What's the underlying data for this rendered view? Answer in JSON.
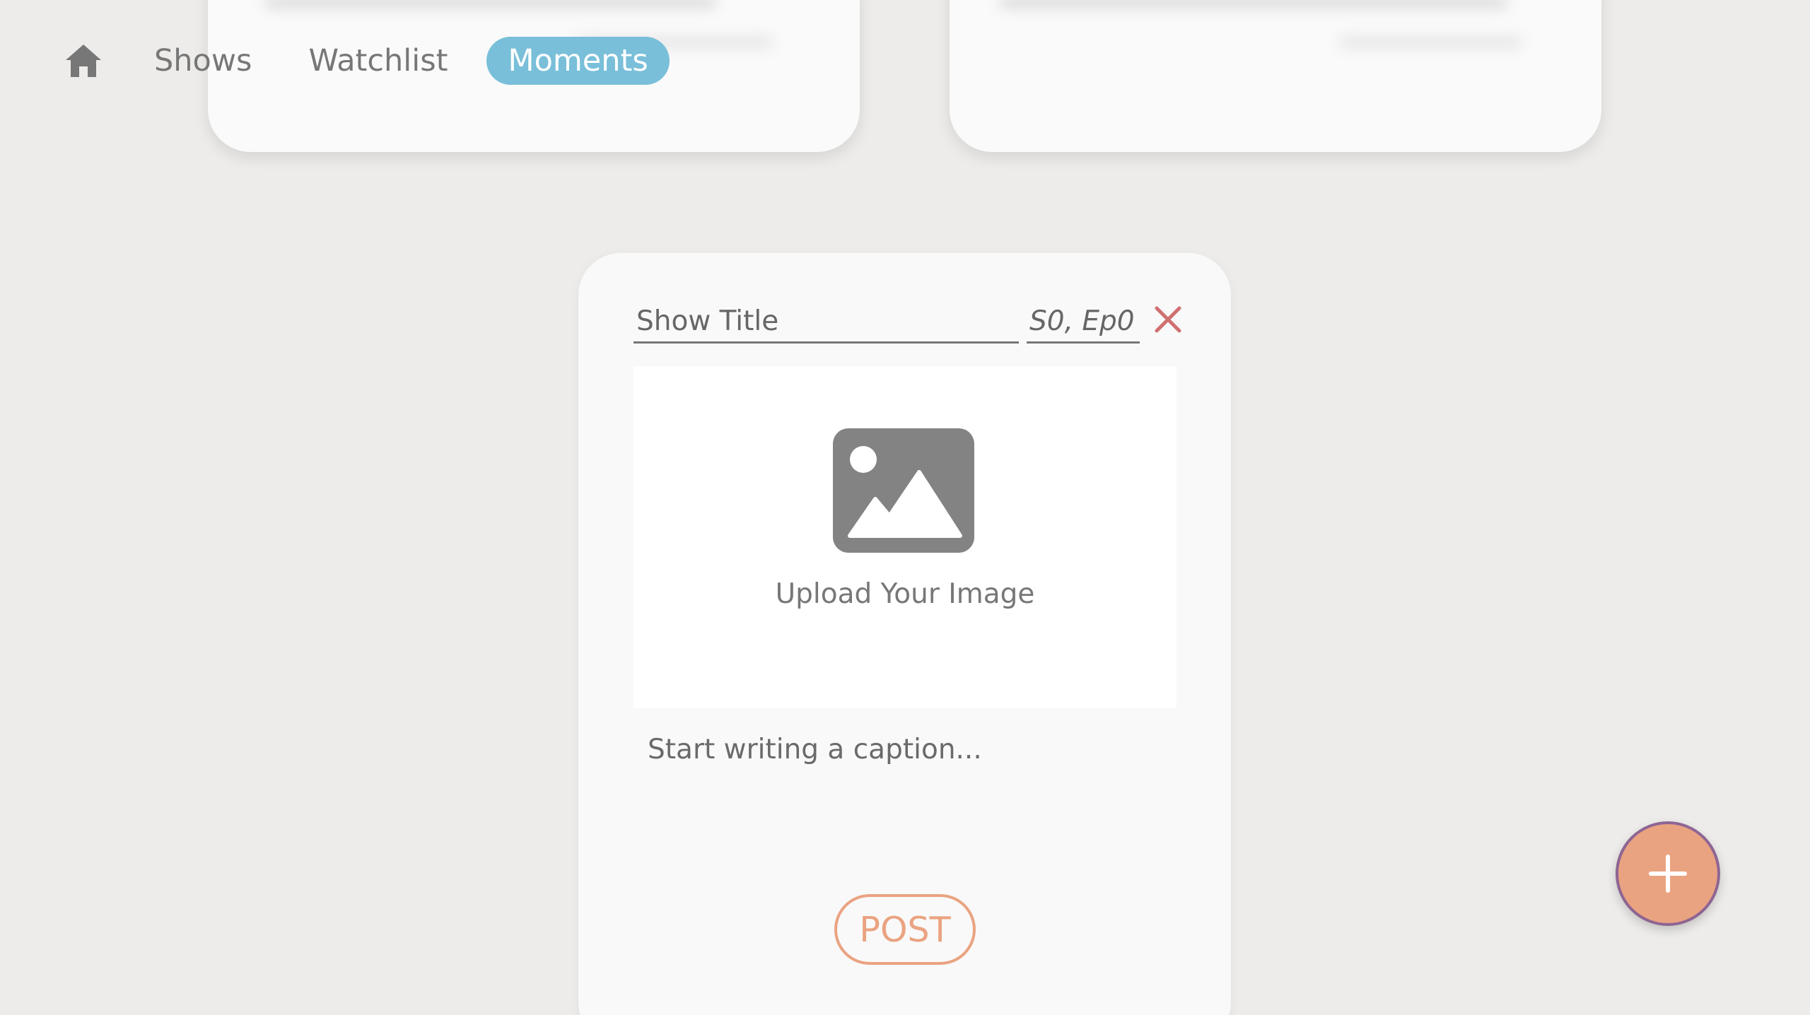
{
  "nav": {
    "home_icon": "home-icon",
    "items": [
      {
        "label": "Shows",
        "active": false
      },
      {
        "label": "Watchlist",
        "active": false
      },
      {
        "label": "Moments",
        "active": true
      }
    ]
  },
  "post_form": {
    "show_title_placeholder": "Show Title",
    "episode_placeholder": "S0, Ep0",
    "close_icon": "close-icon",
    "upload_icon": "image-icon",
    "upload_label": "Upload Your Image",
    "caption_placeholder": "Start writing a caption...",
    "post_label": "POST"
  },
  "fab": {
    "icon": "plus-icon"
  },
  "colors": {
    "background": "#edecea",
    "card": "#f9f9f9",
    "active_tab": "#79bfd9",
    "accent": "#eaa381",
    "fab_border": "#8e6592",
    "close": "#d07070",
    "icon_gray": "#838383"
  }
}
